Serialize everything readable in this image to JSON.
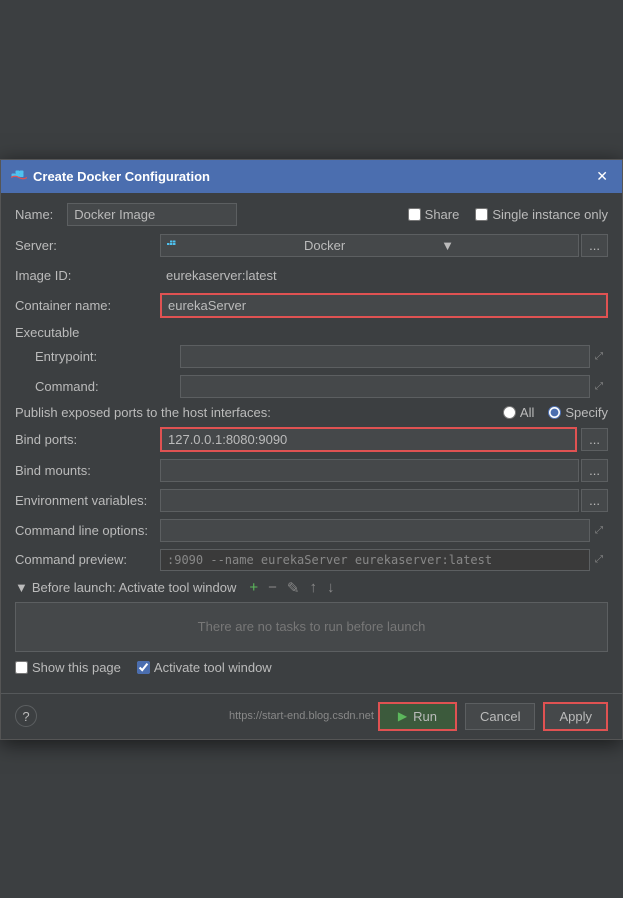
{
  "title_bar": {
    "title": "Create Docker Configuration",
    "close_label": "✕"
  },
  "name_row": {
    "label": "Name:",
    "value": "Docker Image",
    "share_label": "Share",
    "single_instance_label": "Single instance only"
  },
  "server_row": {
    "label": "Server:",
    "value": "Docker",
    "dots_label": "..."
  },
  "image_id_row": {
    "label": "Image ID:",
    "value": "eurekaserver:latest"
  },
  "container_name_row": {
    "label": "Container name:",
    "value": "eurekaServer"
  },
  "executable_section": {
    "label": "Executable"
  },
  "entrypoint_row": {
    "label": "Entrypoint:",
    "value": "",
    "expand_icon": "⤢"
  },
  "command_row": {
    "label": "Command:",
    "value": "",
    "expand_icon": "⤢"
  },
  "publish_ports_row": {
    "label": "Publish exposed ports to the host interfaces:",
    "all_label": "All",
    "specify_label": "Specify"
  },
  "bind_ports_row": {
    "label": "Bind ports:",
    "value": "127.0.0.1:8080:9090",
    "dots_label": "..."
  },
  "bind_mounts_row": {
    "label": "Bind mounts:",
    "value": "",
    "dots_label": "..."
  },
  "env_vars_row": {
    "label": "Environment variables:",
    "value": "",
    "dots_label": "..."
  },
  "cmd_options_row": {
    "label": "Command line options:",
    "value": "",
    "expand_icon": "⤢"
  },
  "cmd_preview_row": {
    "label": "Command preview:",
    "value": ":9090 --name eurekaServer eurekaserver:latest",
    "expand_icon": "⤢"
  },
  "before_launch": {
    "label": "Before launch: Activate tool window",
    "no_tasks_label": "There are no tasks to run before launch",
    "add_icon": "+",
    "remove_icon": "−",
    "edit_icon": "✎",
    "up_icon": "↑",
    "down_icon": "↓"
  },
  "bottom_options": {
    "show_page_label": "Show this page",
    "activate_tool_label": "Activate tool window"
  },
  "footer": {
    "help_label": "?",
    "run_label": "Run",
    "cancel_label": "Cancel",
    "apply_label": "Apply"
  },
  "watermark": "https://start-end.blog.csdn.net"
}
